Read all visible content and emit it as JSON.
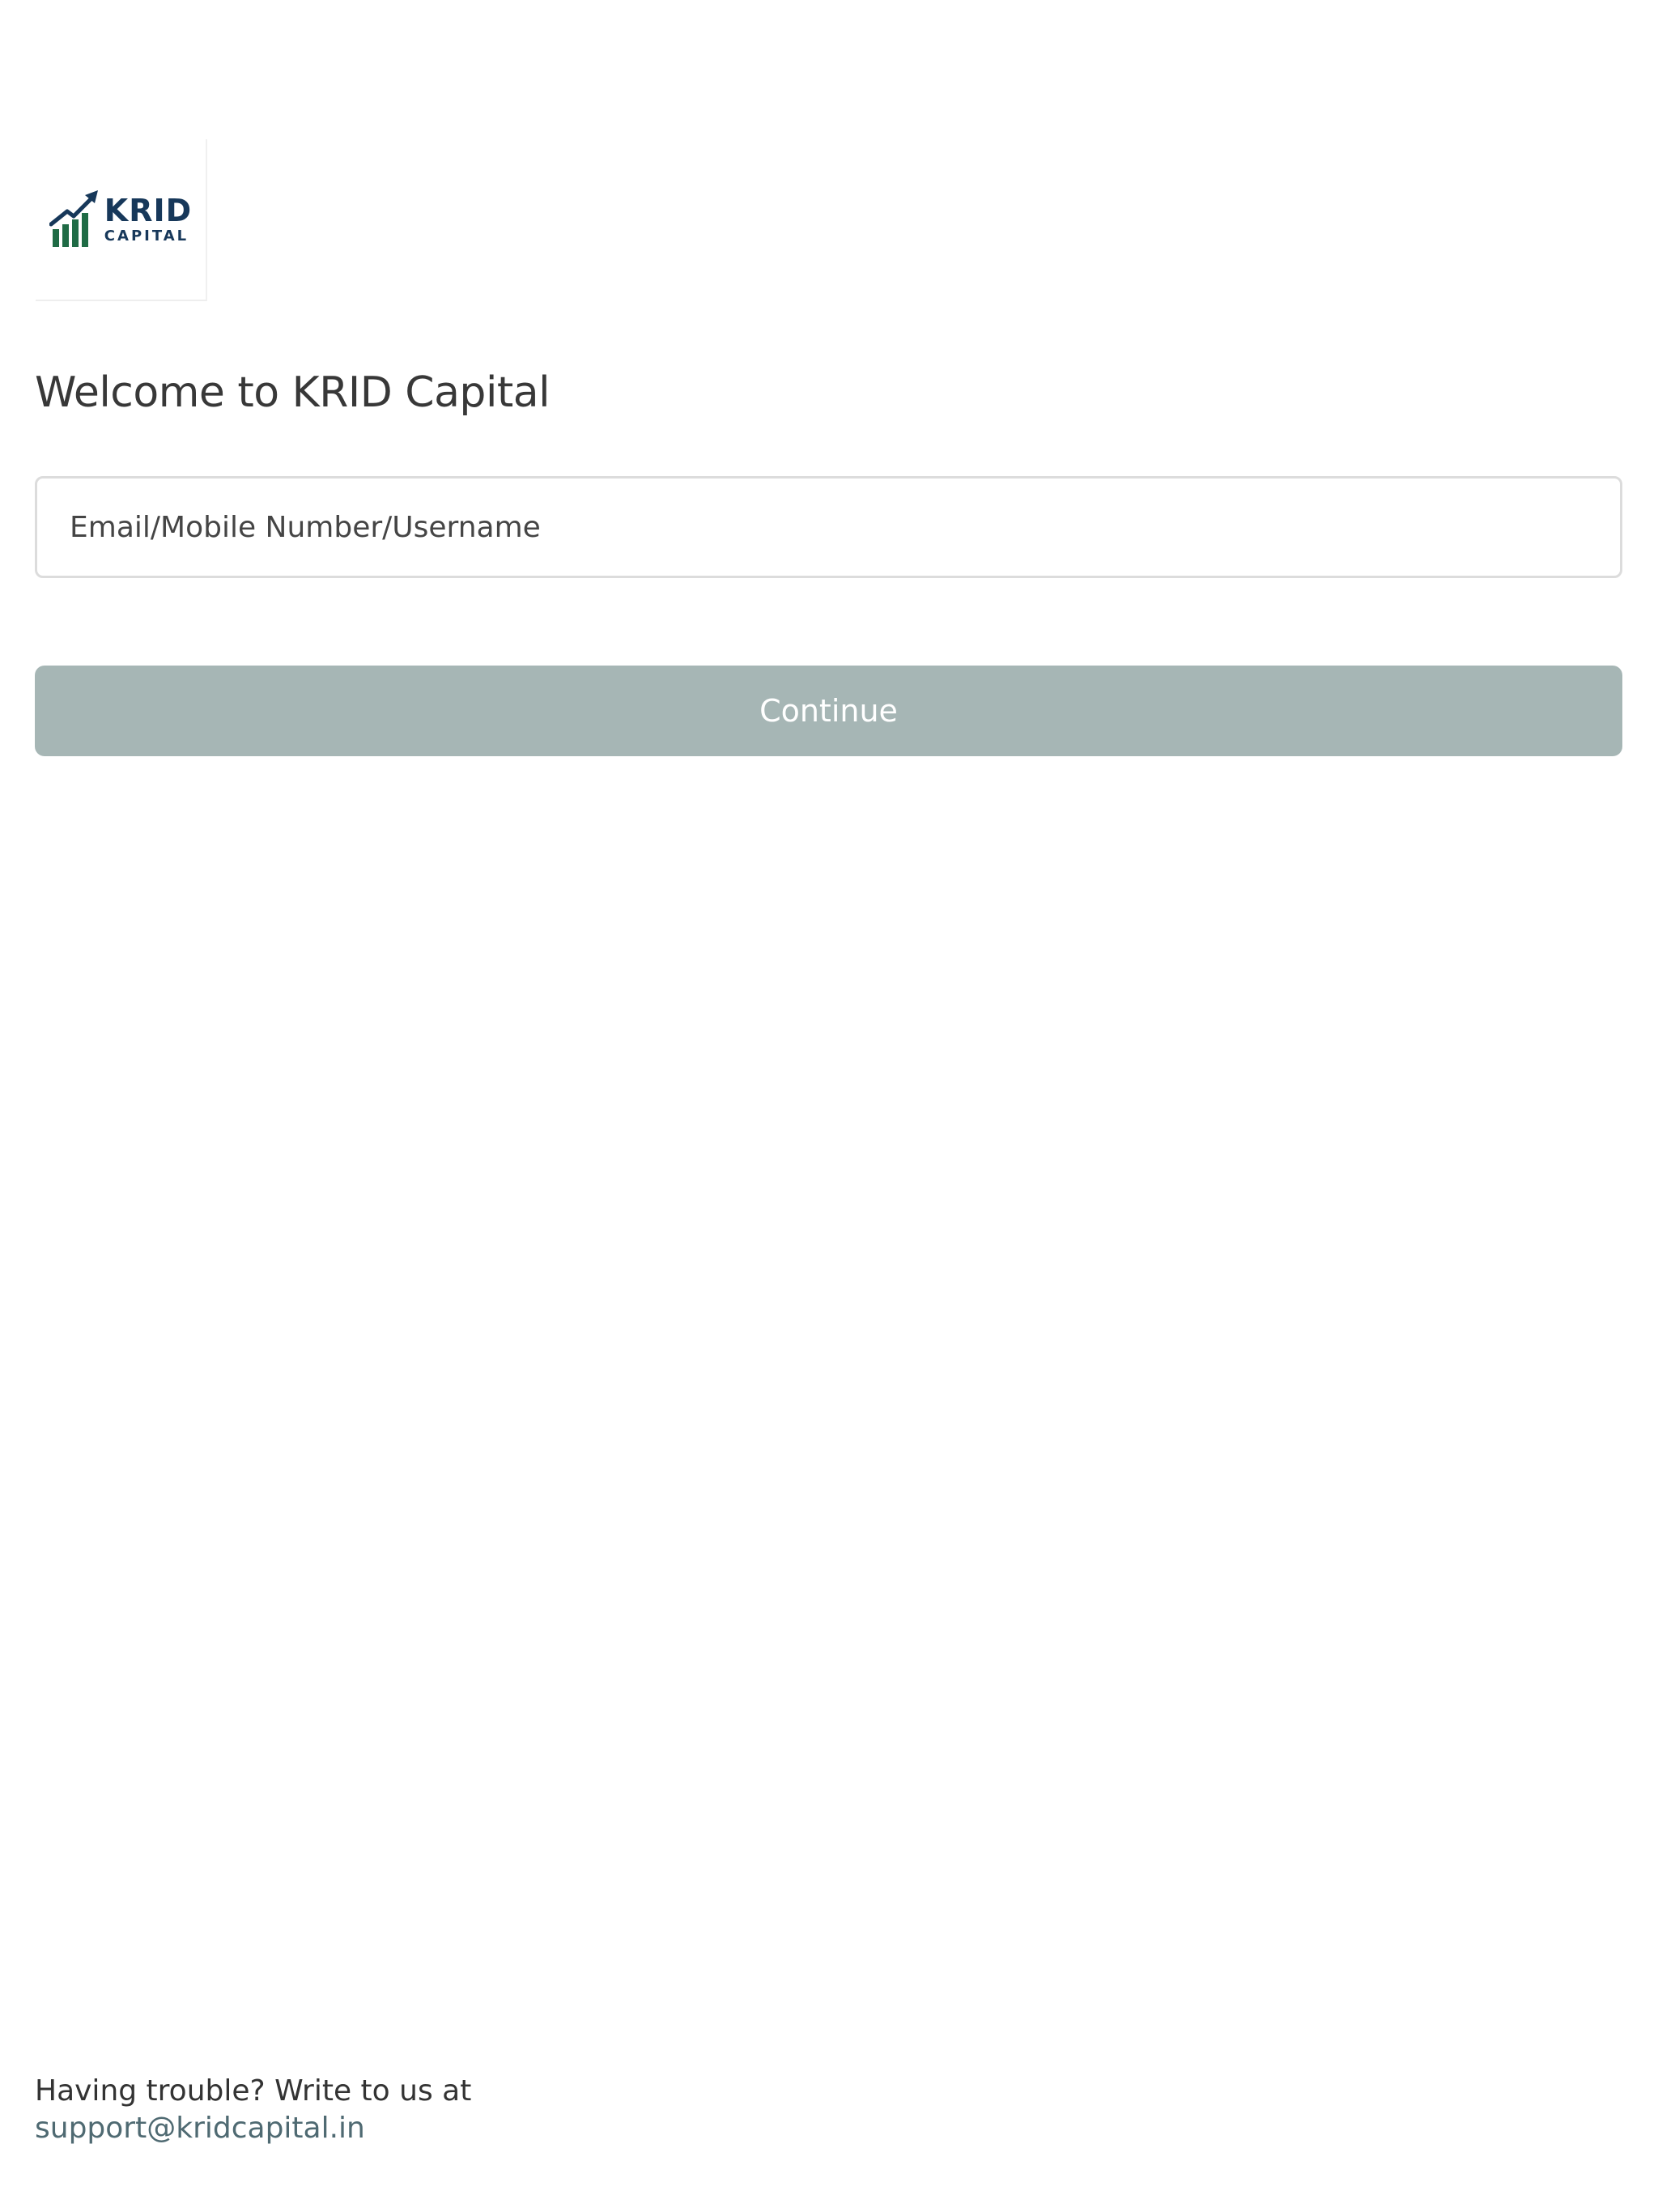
{
  "logo": {
    "title": "KRID",
    "subtitle": "CAPITAL",
    "icon": "bar-chart-arrow-icon",
    "colors": {
      "navy": "#17385a",
      "green": "#1f6b45"
    }
  },
  "header": {
    "title": "Welcome to KRID Capital"
  },
  "login_form": {
    "identifier_placeholder": "Email/Mobile Number/Username",
    "identifier_value": "",
    "continue_label": "Continue",
    "continue_color": "#a6b6b5"
  },
  "footer": {
    "help_text": "Having trouble? Write to us at",
    "support_email": "support@kridcapital.in"
  }
}
